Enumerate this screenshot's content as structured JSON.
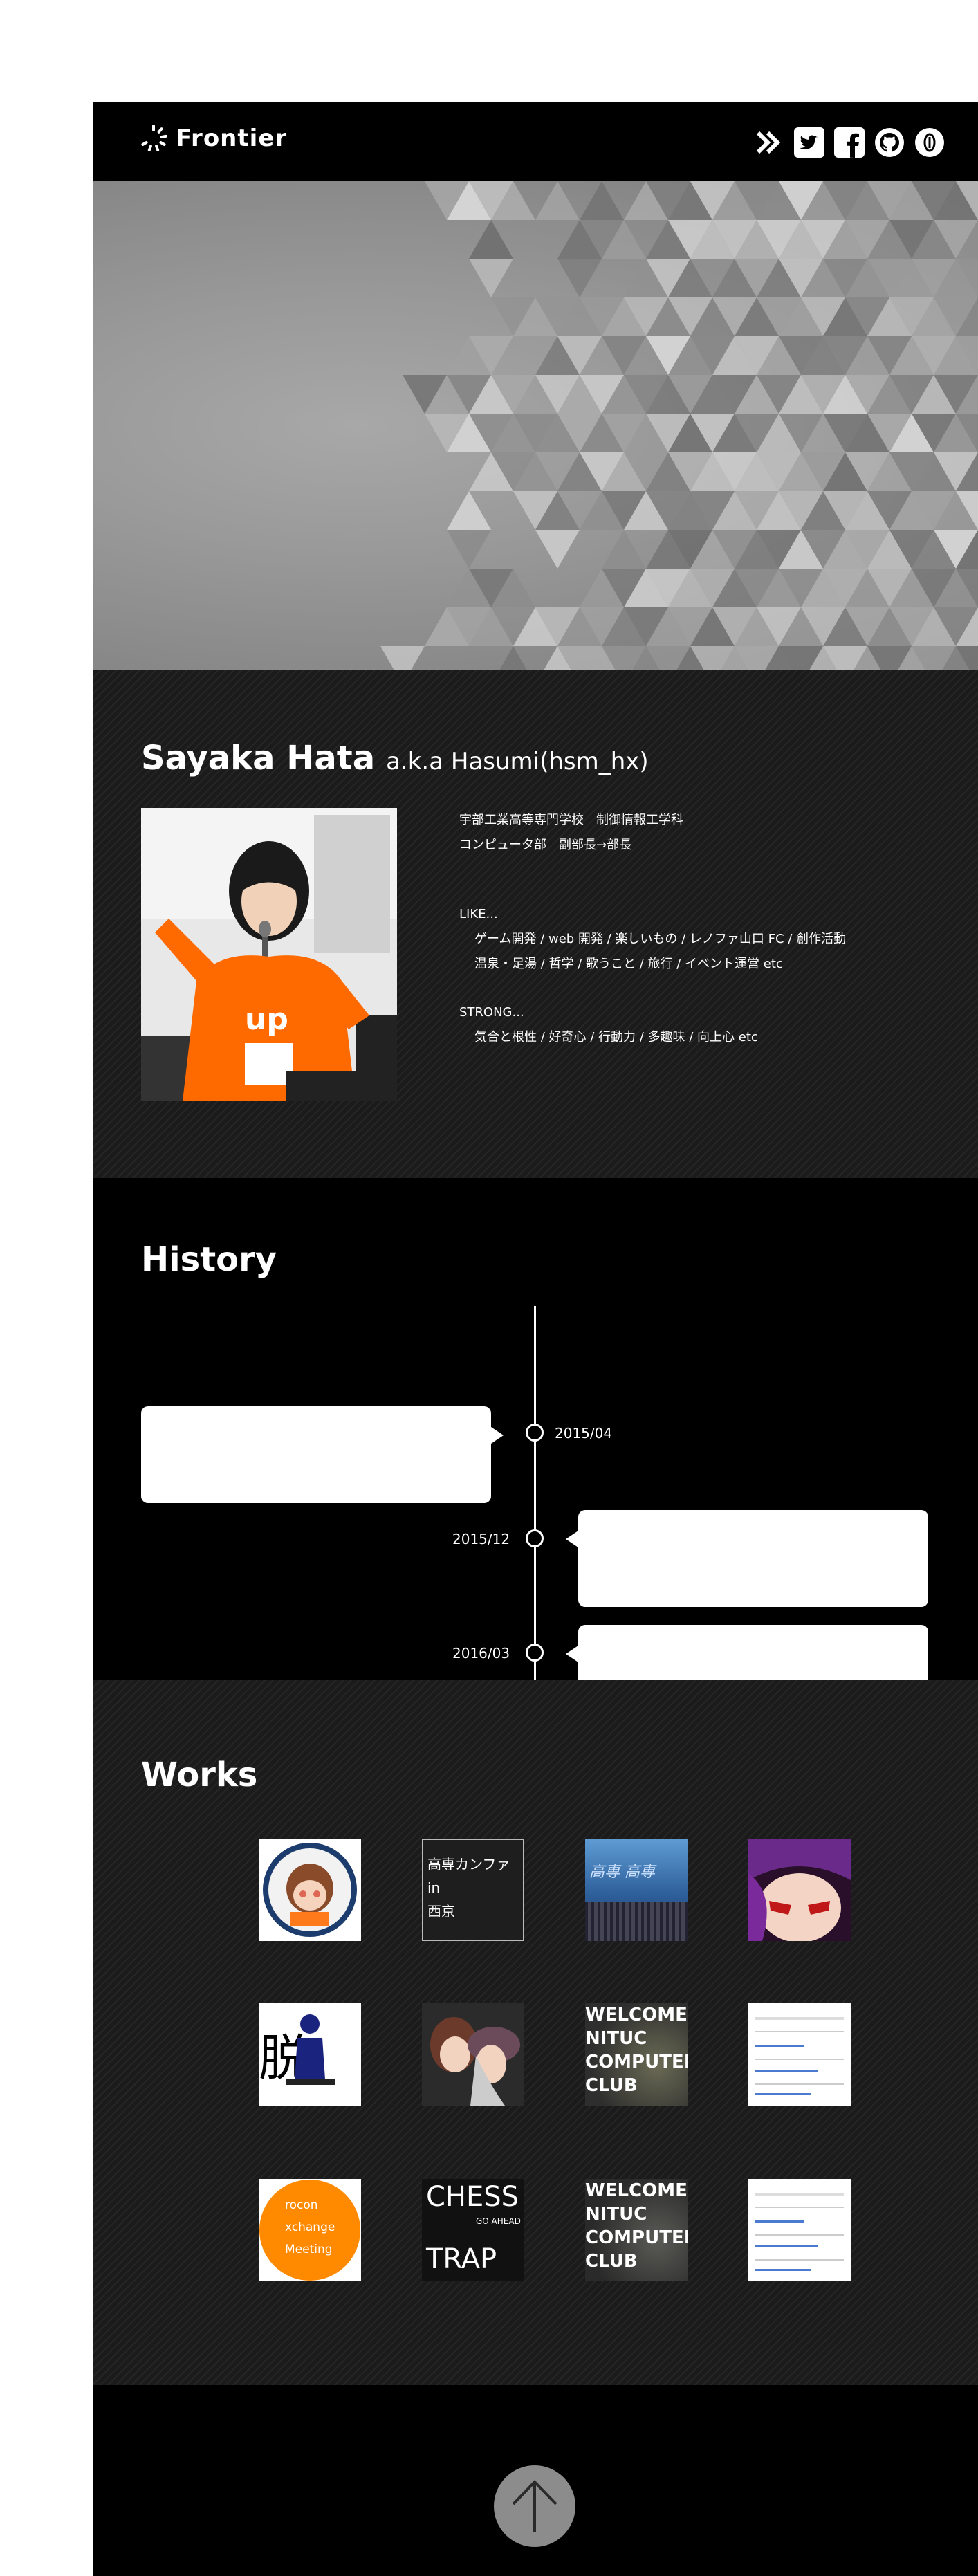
{
  "header": {
    "logo_text": "Frontier",
    "icons": [
      "chevron-double-right-icon",
      "twitter-icon",
      "facebook-icon",
      "github-icon",
      "info-icon"
    ]
  },
  "profile": {
    "name": "Sayaka Hata",
    "alias": "a.k.a Hasumi(hsm_hx)",
    "school": "宇部工業高等専門学校　制御情報工学科",
    "club": "コンピュータ部　副部長→部長",
    "like_heading": "LIKE...",
    "like_line1": "ゲーム開発 / web 開発 / 楽しいもの / レノファ山口 FC / 創作活動",
    "like_line2": "温泉・足湯 / 哲学 / 歌うこと / 旅行 / イベント運営 etc",
    "strong_heading": "STRONG...",
    "strong_line1": "気合と根性 / 好奇心 / 行動力 / 多趣味 / 向上心  etc"
  },
  "history": {
    "title": "History",
    "events": [
      {
        "date": "2015/04"
      },
      {
        "date": "2015/12"
      },
      {
        "date": "2016/03"
      }
    ]
  },
  "works": {
    "title": "Works",
    "items": [
      {
        "label": ""
      },
      {
        "label_line1": "高専カンファ",
        "label_line2": "in",
        "label_line3": "西京"
      },
      {
        "label": "高専 高専"
      },
      {
        "label": ""
      },
      {
        "label": "脱 力"
      },
      {
        "label": ""
      },
      {
        "label_line1": "WELCOME",
        "label_line2": "NITUC",
        "label_line3": "COMPUTER",
        "label_line4": "CLUB"
      },
      {
        "label": ""
      },
      {
        "label_line1": "rocon",
        "label_line2": "xchange",
        "label_line3": "Meeting"
      },
      {
        "label_line1": "CHESS",
        "label_line2": "GO AHEAD",
        "label_line3": "TRAP"
      },
      {
        "label_line1": "WELCOME",
        "label_line2": "NITUC",
        "label_line3": "COMPUTER",
        "label_line4": "CLUB"
      },
      {
        "label": ""
      }
    ]
  },
  "colors": {
    "page_bg": "#000000",
    "panel_stripe": "#1e1e1e",
    "accent_orange": "#ff8a00",
    "top_button": "#8c8c8c"
  }
}
